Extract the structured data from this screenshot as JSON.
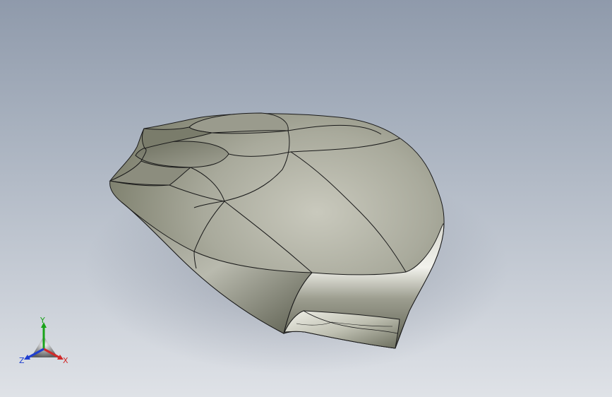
{
  "viewport": {
    "background_top": "#8f9aab",
    "background_bottom": "#dfe2e7"
  },
  "model": {
    "surface_color": "#a8a999",
    "edge_color": "#1a1a1a"
  },
  "triad": {
    "x_label": "X",
    "y_label": "Y",
    "z_label": "Z",
    "x_color": "#d02a2a",
    "y_color": "#1aa31a",
    "z_color": "#1f3fd0"
  }
}
